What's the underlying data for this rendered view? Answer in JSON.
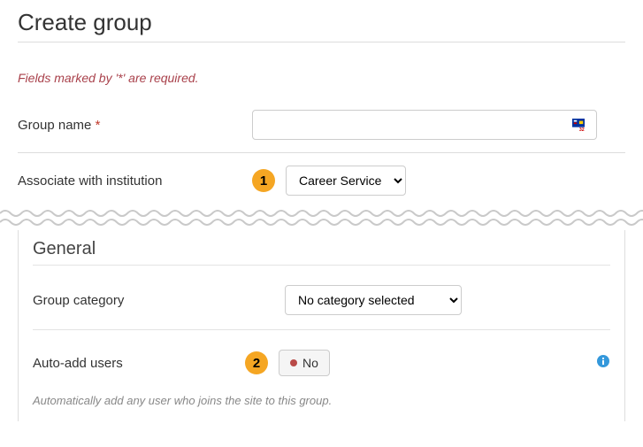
{
  "title": "Create group",
  "required_note": "Fields marked by '*' are required.",
  "group_name": {
    "label": "Group name",
    "required_marker": "*",
    "value": ""
  },
  "associate_institution": {
    "label": "Associate with institution",
    "selected": "Career Service"
  },
  "annotations": {
    "one": "1",
    "two": "2"
  },
  "general": {
    "heading": "General",
    "group_category": {
      "label": "Group category",
      "selected": "No category selected"
    },
    "auto_add": {
      "label": "Auto-add users",
      "toggle_text": "No",
      "help": "Automatically add any user who joins the site to this group."
    }
  }
}
